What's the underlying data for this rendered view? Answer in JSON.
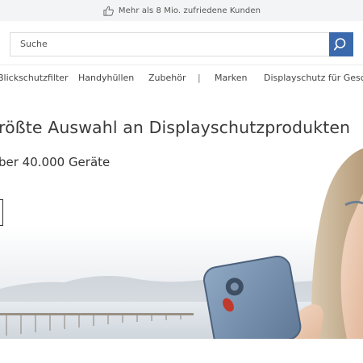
{
  "topbar": {
    "text": "Mehr als 8 Mio. zufriedene Kunden",
    "icon": "thumbs-up-icon"
  },
  "search": {
    "placeholder": "Suche",
    "button_icon": "search-icon",
    "button_color": "#3a69ad"
  },
  "nav": {
    "items": [
      "Blickschutzfilter",
      "Handyhüllen",
      "Zubehör",
      "|",
      "Marken",
      "Displayschutz für Geschä"
    ]
  },
  "hero": {
    "headline": "rößte Auswahl an Displayschutzprodukten",
    "subline": "ber 40.000 Geräte"
  }
}
